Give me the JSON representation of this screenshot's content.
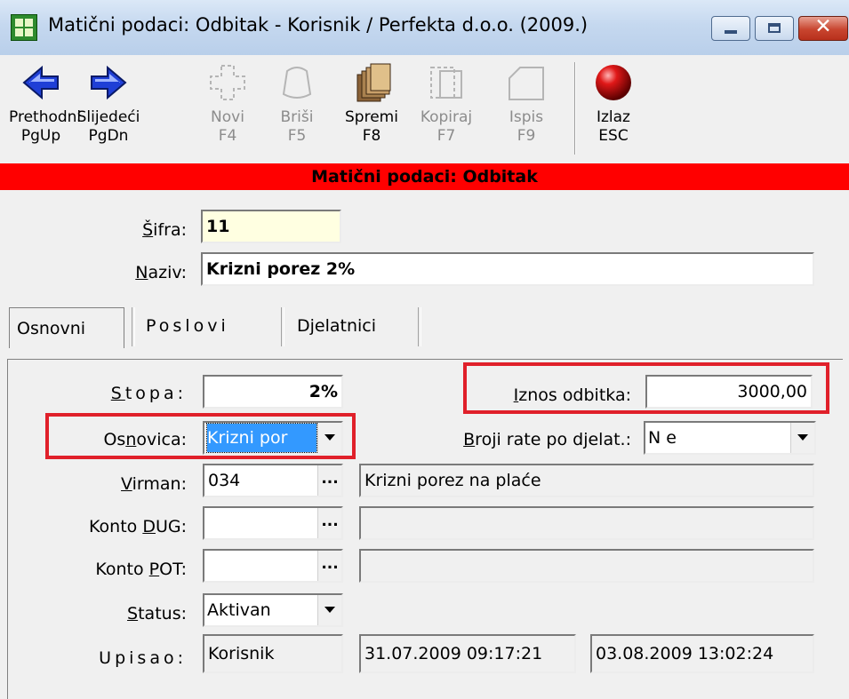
{
  "window": {
    "title": "Matični podaci: Odbitak - Korisnik / Perfekta d.o.o. (2009.)",
    "close_glyph": "✕"
  },
  "toolbar": {
    "items": [
      {
        "line1": "Prethodni",
        "line2": "PgUp",
        "icon": "arrow-left-icon",
        "enabled": true
      },
      {
        "line1": "Slijedeći",
        "line2": "PgDn",
        "icon": "arrow-right-icon",
        "enabled": true
      },
      {
        "line1": "Novi",
        "line2": "F4",
        "icon": "new-icon",
        "enabled": false
      },
      {
        "line1": "Briši",
        "line2": "F5",
        "icon": "delete-icon",
        "enabled": false
      },
      {
        "line1": "Spremi",
        "line2": "F8",
        "icon": "save-icon",
        "enabled": true
      },
      {
        "line1": "Kopiraj",
        "line2": "F7",
        "icon": "copy-icon",
        "enabled": false
      },
      {
        "line1": "Ispis",
        "line2": "F9",
        "icon": "print-icon",
        "enabled": false
      },
      {
        "line1": "Izlaz",
        "line2": "ESC",
        "icon": "exit-icon",
        "enabled": true
      }
    ]
  },
  "banner": {
    "title": "Matični podaci: Odbitak",
    "color": "#ff0000"
  },
  "header": {
    "sifra_label_first": "Š",
    "sifra_label_rest": "ifra:",
    "sifra_value": "11",
    "naziv_label_first": "N",
    "naziv_label_rest": "aziv:",
    "naziv_value": "Krizni porez 2%"
  },
  "tabs": [
    {
      "label": "Osnovni",
      "active": true
    },
    {
      "label": "Poslovi",
      "active": false
    },
    {
      "label": "Djelatnici",
      "active": false
    }
  ],
  "form": {
    "stopa": {
      "label_first": "S",
      "label_rest": "topa:",
      "value": "2%"
    },
    "iznos_odbitka": {
      "label_first": "I",
      "label_rest": "znos odbitka:",
      "value": "3000,00"
    },
    "osnovica": {
      "label_pre": "Os",
      "label_u": "n",
      "label_post": "ovica:",
      "value": "Krizni por"
    },
    "broji_rate": {
      "label_first": "B",
      "label_rest": "roji rate po djelat.:",
      "value": "N e"
    },
    "virman": {
      "label_first": "V",
      "label_rest": "irman:",
      "code": "034",
      "description": "Krizni porez na plaće"
    },
    "konto_dug": {
      "label_pre": "Konto ",
      "label_u": "D",
      "label_post": "UG:",
      "code": "",
      "description": ""
    },
    "konto_pot": {
      "label_pre": "Konto ",
      "label_u": "P",
      "label_post": "OT:",
      "code": "",
      "description": ""
    },
    "status": {
      "label_first": "S",
      "label_rest": "tatus:",
      "value": "Aktivan"
    },
    "upisao": {
      "label": "Upisao:",
      "user": "Korisnik",
      "created": "31.07.2009 09:17:21",
      "modified": "03.08.2009 13:02:24"
    },
    "ellipsis": "..."
  },
  "annotation_color": "#e0202a"
}
